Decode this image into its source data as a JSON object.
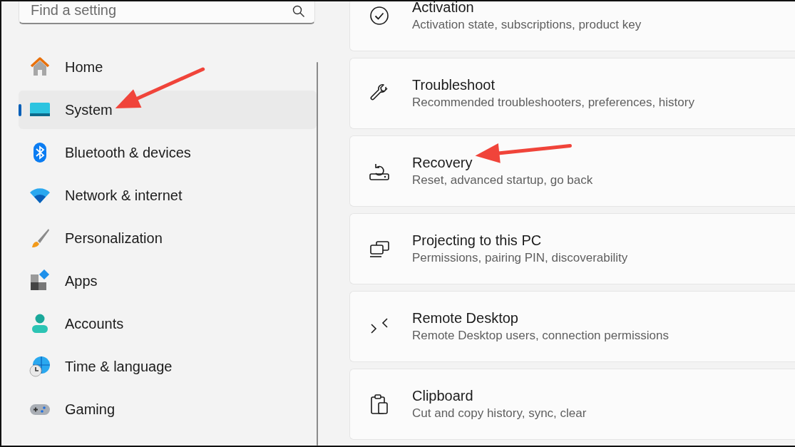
{
  "search": {
    "placeholder": "Find a setting"
  },
  "sidebar": {
    "items": [
      {
        "kind": "home",
        "label": "Home",
        "selected": false,
        "arrow": false
      },
      {
        "kind": "system",
        "label": "System",
        "selected": true,
        "arrow": true
      },
      {
        "kind": "bluetooth",
        "label": "Bluetooth & devices",
        "selected": false,
        "arrow": false
      },
      {
        "kind": "network",
        "label": "Network & internet",
        "selected": false,
        "arrow": false
      },
      {
        "kind": "personalization",
        "label": "Personalization",
        "selected": false,
        "arrow": false
      },
      {
        "kind": "apps",
        "label": "Apps",
        "selected": false,
        "arrow": false
      },
      {
        "kind": "accounts",
        "label": "Accounts",
        "selected": false,
        "arrow": false
      },
      {
        "kind": "time",
        "label": "Time & language",
        "selected": false,
        "arrow": false
      },
      {
        "kind": "gaming",
        "label": "Gaming",
        "selected": false,
        "arrow": false
      }
    ]
  },
  "cards": [
    {
      "kind": "activation",
      "title": "Activation",
      "subtitle": "Activation state, subscriptions, product key",
      "arrow": false
    },
    {
      "kind": "troubleshoot",
      "title": "Troubleshoot",
      "subtitle": "Recommended troubleshooters, preferences, history",
      "arrow": false
    },
    {
      "kind": "recovery",
      "title": "Recovery",
      "subtitle": "Reset, advanced startup, go back",
      "arrow": true
    },
    {
      "kind": "projecting",
      "title": "Projecting to this PC",
      "subtitle": "Permissions, pairing PIN, discoverability",
      "arrow": false
    },
    {
      "kind": "remote",
      "title": "Remote Desktop",
      "subtitle": "Remote Desktop users, connection permissions",
      "arrow": false
    },
    {
      "kind": "clipboard",
      "title": "Clipboard",
      "subtitle": "Cut and copy history, sync, clear",
      "arrow": false
    }
  ]
}
